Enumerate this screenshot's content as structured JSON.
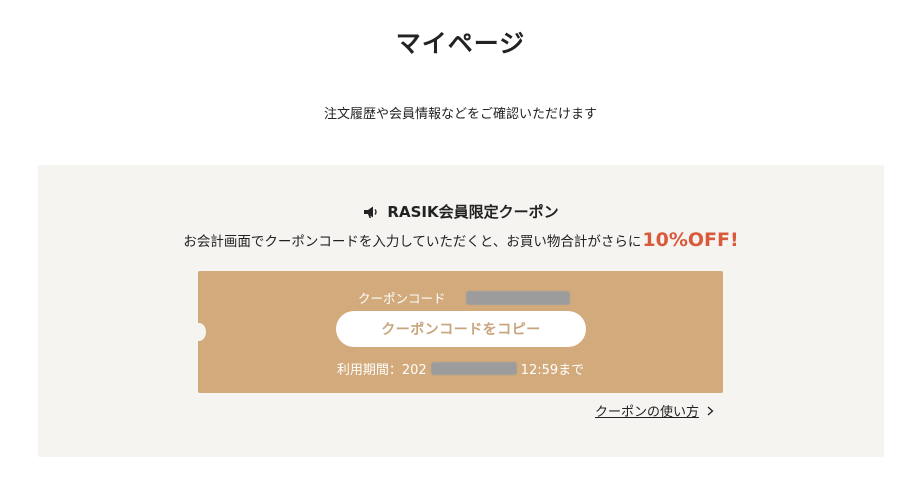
{
  "page": {
    "title": "マイページ",
    "subtitle": "注文履歴や会員情報などをご確認いただけます"
  },
  "coupon": {
    "heading": "RASIK会員限定クーポン",
    "heading_icon": "megaphone-icon",
    "description": "お会計画面でクーポンコードを入力していただくと、お買い物合計がさらに",
    "highlight": "10%OFF!",
    "code_label": "クーポンコード",
    "copy_button_label": "クーポンコードをコピー",
    "period_label": "利用期間：202",
    "period_suffix": "12:59まで",
    "howto_link_label": "クーポンの使い方",
    "howto_icon": "chevron-right-icon"
  },
  "colors": {
    "panel_bg": "#f6f4f1",
    "ticket_bg": "#d2aa7b",
    "highlight": "#d95a3a",
    "button_text": "#c8a57c"
  }
}
